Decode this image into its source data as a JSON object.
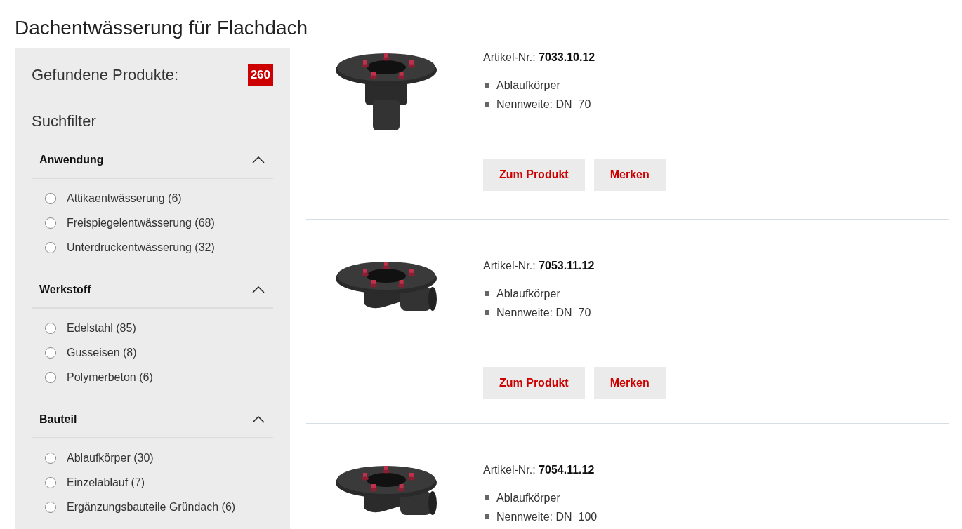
{
  "page_title": "Dachentwässerung für Flachdach",
  "sidebar": {
    "found_label": "Gefundene Produkte:",
    "found_count": "260",
    "filter_title": "Suchfilter",
    "sections": [
      {
        "title": "Anwendung",
        "expanded": true,
        "options": [
          {
            "label": "Attikaentwässerung (6)",
            "selected": false
          },
          {
            "label": "Freispiegelentwässerung (68)",
            "selected": false
          },
          {
            "label": "Unterdruckentwässerung (32)",
            "selected": false
          }
        ]
      },
      {
        "title": "Werkstoff",
        "expanded": true,
        "options": [
          {
            "label": "Edelstahl (85)",
            "selected": false
          },
          {
            "label": "Gusseisen (8)",
            "selected": false
          },
          {
            "label": "Polymerbeton (6)",
            "selected": false
          }
        ]
      },
      {
        "title": "Bauteil",
        "expanded": true,
        "options": [
          {
            "label": "Ablaufkörper (30)",
            "selected": false
          },
          {
            "label": "Einzelablauf (7)",
            "selected": false
          },
          {
            "label": "Ergänzungsbauteile Gründach (6)",
            "selected": false
          }
        ]
      }
    ]
  },
  "products": [
    {
      "kind": "vertical",
      "article_label": "Artikel-Nr.:",
      "article_number": "7033.10.12",
      "features": [
        "Ablaufkörper",
        "Nennweite: DN  70"
      ],
      "buttons": [
        "Zum Produkt",
        "Merken"
      ]
    },
    {
      "kind": "horizontal",
      "article_label": "Artikel-Nr.:",
      "article_number": "7053.11.12",
      "features": [
        "Ablaufkörper",
        "Nennweite: DN  70"
      ],
      "buttons": [
        "Zum Produkt",
        "Merken"
      ]
    },
    {
      "kind": "horizontal",
      "article_label": "Artikel-Nr.:",
      "article_number": "7054.11.12",
      "features": [
        "Ablaufkörper",
        "Nennweite: DN  100"
      ]
    }
  ]
}
